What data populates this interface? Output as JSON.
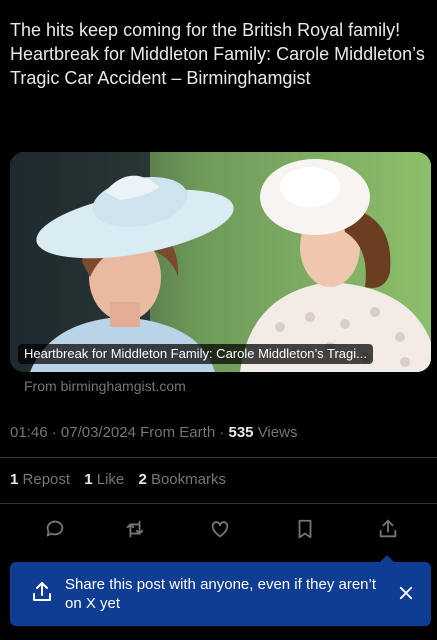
{
  "post": {
    "text": "The hits keep coming for the British Royal family! Heartbreak for Middleton Family: Carole Middleton’s Tragic Car Accident – Birminghamgist"
  },
  "link_card": {
    "caption": "Heartbreak for Middleton Family: Carole Middleton’s Tragi...",
    "source": "From birminghamgist.com"
  },
  "meta": {
    "time": "01:46",
    "separator": " · ",
    "date": "07/03/2024",
    "client": "From Earth",
    "views_count": "535",
    "views_label": "Views"
  },
  "stats": {
    "reposts_count": "1",
    "reposts_label": "Repost",
    "likes_count": "1",
    "likes_label": "Like",
    "bookmarks_count": "2",
    "bookmarks_label": "Bookmarks"
  },
  "actions": {
    "icons": [
      "reply-icon",
      "repost-icon",
      "like-icon",
      "bookmark-icon",
      "share-icon"
    ],
    "icon_color": "#71767b"
  },
  "toast": {
    "text": "Share this post with anyone, even if they aren’t on X yet",
    "background": "#0f3d93"
  },
  "colors": {
    "background": "#000000",
    "primary_text": "#e7e9ea",
    "secondary_text": "#71767b"
  }
}
